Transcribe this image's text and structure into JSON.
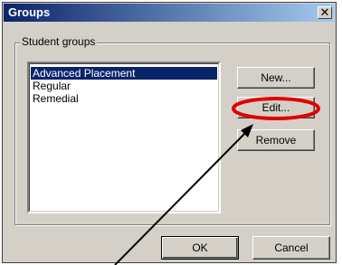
{
  "window": {
    "title": "Groups",
    "close_icon": "close-icon"
  },
  "group": {
    "legend": "Student groups",
    "items": [
      {
        "label": "Advanced Placement",
        "selected": true
      },
      {
        "label": "Regular",
        "selected": false
      },
      {
        "label": "Remedial",
        "selected": false
      }
    ]
  },
  "buttons": {
    "new_label": "New...",
    "edit_label": "Edit...",
    "remove_label": "Remove",
    "ok_label": "OK",
    "cancel_label": "Cancel"
  },
  "annotation": {
    "highlight_color": "#e00000",
    "arrow_color": "#000000"
  }
}
